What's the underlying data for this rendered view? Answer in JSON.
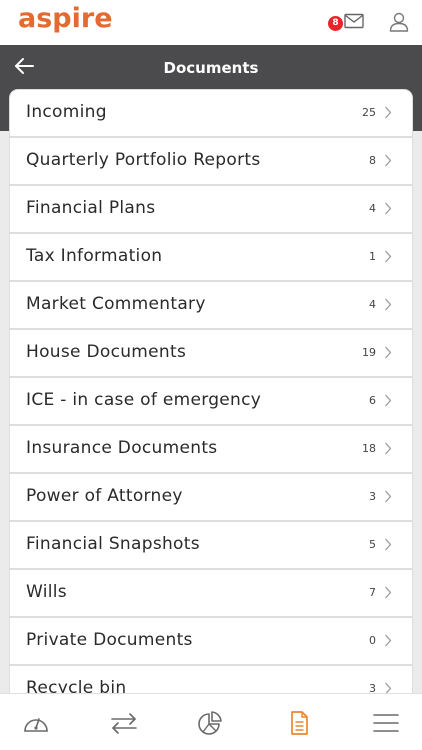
{
  "brand": {
    "logo_text": "aspire",
    "accent": "#e56a32"
  },
  "topbar": {
    "mail_badge": "8",
    "icons": [
      "mail-icon",
      "user-icon"
    ]
  },
  "header": {
    "title": "Documents",
    "back_icon": "arrow-left-icon"
  },
  "documents": [
    {
      "label": "Incoming",
      "count": "25"
    },
    {
      "label": "Quarterly Portfolio Reports",
      "count": "8"
    },
    {
      "label": "Financial Plans",
      "count": "4"
    },
    {
      "label": "Tax Information",
      "count": "1"
    },
    {
      "label": "Market Commentary",
      "count": "4"
    },
    {
      "label": "House Documents",
      "count": "19"
    },
    {
      "label": "ICE - in case of emergency",
      "count": "6"
    },
    {
      "label": "Insurance Documents",
      "count": "18"
    },
    {
      "label": "Power of Attorney",
      "count": "3"
    },
    {
      "label": "Financial Snapshots",
      "count": "5"
    },
    {
      "label": "Wills",
      "count": "7"
    },
    {
      "label": "Private Documents",
      "count": "0"
    },
    {
      "label": "Recycle bin",
      "count": "3"
    }
  ],
  "bottom_nav": {
    "items": [
      "dashboard-gauge-icon",
      "transfer-arrows-icon",
      "portfolio-pie-icon",
      "documents-icon",
      "menu-icon"
    ],
    "active": "documents-icon",
    "active_color": "#e8882e",
    "inactive_color": "#6a6a6a"
  }
}
